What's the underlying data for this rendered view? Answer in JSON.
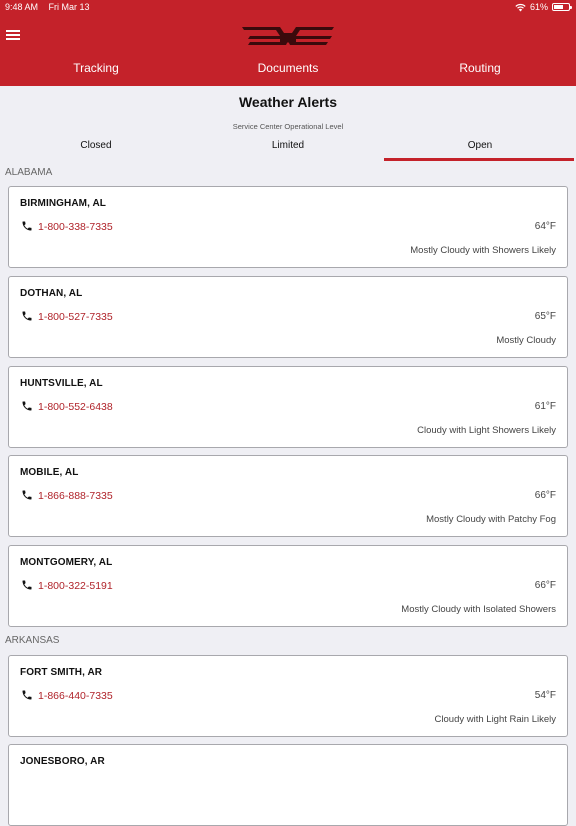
{
  "status": {
    "time": "9:48 AM",
    "date": "Fri Mar 13",
    "battery": "61%",
    "battery_level": 0.61
  },
  "nav": {
    "tabs": [
      "Tracking",
      "Documents",
      "Routing"
    ]
  },
  "page": {
    "title": "Weather Alerts",
    "subtitle": "Service Center Operational Level"
  },
  "levels": {
    "tabs": [
      "Closed",
      "Limited",
      "Open"
    ],
    "selected": "Open"
  },
  "colors": {
    "brand": "#c4222a",
    "phone_link": "#b0232a"
  },
  "sections": [
    {
      "name": "ALABAMA",
      "centers": [
        {
          "city": "BIRMINGHAM, AL",
          "phone": "1-800-338-7335",
          "temp": "64°F",
          "conditions": "Mostly Cloudy with Showers Likely"
        },
        {
          "city": "DOTHAN, AL",
          "phone": "1-800-527-7335",
          "temp": "65°F",
          "conditions": "Mostly Cloudy"
        },
        {
          "city": "HUNTSVILLE, AL",
          "phone": "1-800-552-6438",
          "temp": "61°F",
          "conditions": "Cloudy with Light Showers Likely"
        },
        {
          "city": "MOBILE, AL",
          "phone": "1-866-888-7335",
          "temp": "66°F",
          "conditions": "Mostly Cloudy with Patchy Fog"
        },
        {
          "city": "MONTGOMERY, AL",
          "phone": "1-800-322-5191",
          "temp": "66°F",
          "conditions": "Mostly Cloudy with Isolated Showers"
        }
      ]
    },
    {
      "name": "ARKANSAS",
      "centers": [
        {
          "city": "FORT SMITH, AR",
          "phone": "1-866-440-7335",
          "temp": "54°F",
          "conditions": "Cloudy with Light Rain Likely"
        },
        {
          "city": "JONESBORO, AR",
          "phone": "",
          "temp": "",
          "conditions": ""
        }
      ]
    }
  ]
}
